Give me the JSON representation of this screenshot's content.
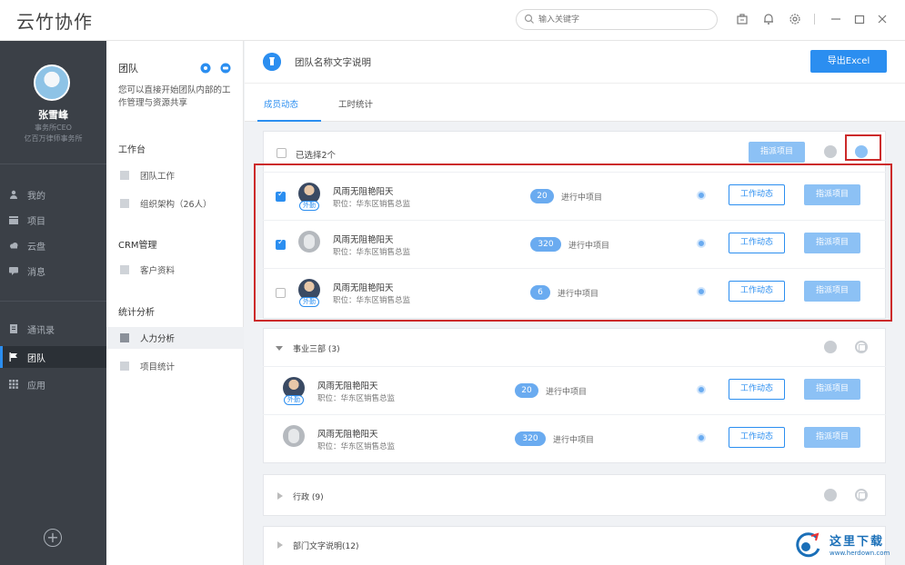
{
  "app": {
    "title": "云竹协作"
  },
  "topbar": {
    "search_placeholder": "输入关键字"
  },
  "user": {
    "name": "张雪峰",
    "role": "事务所CEO",
    "org": "亿百万律师事务所"
  },
  "sidebar": {
    "items": [
      {
        "label": "我的",
        "icon": "person-icon"
      },
      {
        "label": "项目",
        "icon": "project-icon"
      },
      {
        "label": "云盘",
        "icon": "cloud-icon"
      },
      {
        "label": "消息",
        "icon": "message-icon"
      },
      {
        "label": "通讯录",
        "icon": "contacts-icon"
      },
      {
        "label": "团队",
        "icon": "flag-icon",
        "active": true
      },
      {
        "label": "应用",
        "icon": "apps-icon"
      }
    ],
    "add_symbol": "+"
  },
  "panel2": {
    "title": "团队",
    "desc": "您可以直接开始团队内部的工作管理与资源共享",
    "section_workbench": "工作台",
    "item_team_work": "团队工作",
    "item_org": "组织架构（26人）",
    "section_crm": "CRM管理",
    "item_customers": "客户资料",
    "section_stats": "统计分析",
    "item_hr": "人力分析",
    "item_project_stats": "项目统计"
  },
  "main": {
    "title": "团队名称文字说明",
    "export_label": "导出Excel",
    "tabs": [
      {
        "label": "成员动态",
        "active": true
      },
      {
        "label": "工时统计"
      }
    ],
    "selected_label": "已选择2个",
    "assign_label": "指派项目",
    "work_label": "工作动态",
    "projects_suffix": "进行中项目",
    "out_tag": "外勤"
  },
  "group1": {
    "rows": [
      {
        "name": "风雨无阻艳阳天",
        "position": "职位：华东区销售总监",
        "count": "20",
        "checked": true,
        "avatar": "photo",
        "out": true
      },
      {
        "name": "风雨无阻艳阳天",
        "position": "职位：华东区销售总监",
        "count": "320",
        "checked": true,
        "avatar": "blank",
        "out": false
      },
      {
        "name": "风雨无阻艳阳天",
        "position": "职位：华东区销售总监",
        "count": "6",
        "checked": false,
        "avatar": "photo",
        "out": true
      }
    ]
  },
  "group2": {
    "label": "事业三部 (3)",
    "rows": [
      {
        "name": "风雨无阻艳阳天",
        "position": "职位：华东区销售总监",
        "count": "20",
        "avatar": "photo",
        "out": true
      },
      {
        "name": "风雨无阻艳阳天",
        "position": "职位：华东区销售总监",
        "count": "320",
        "avatar": "blank",
        "out": false
      }
    ]
  },
  "group3": {
    "label": "行政 (9)"
  },
  "group4": {
    "label": "部门文字说明(12)"
  },
  "watermark": {
    "cn": "这里下载",
    "url": "www.herdown.com"
  },
  "colors": {
    "accent": "#2b8ef0",
    "sidebar_bg": "#3b4047",
    "highlight_box": "#cc2a2a"
  }
}
